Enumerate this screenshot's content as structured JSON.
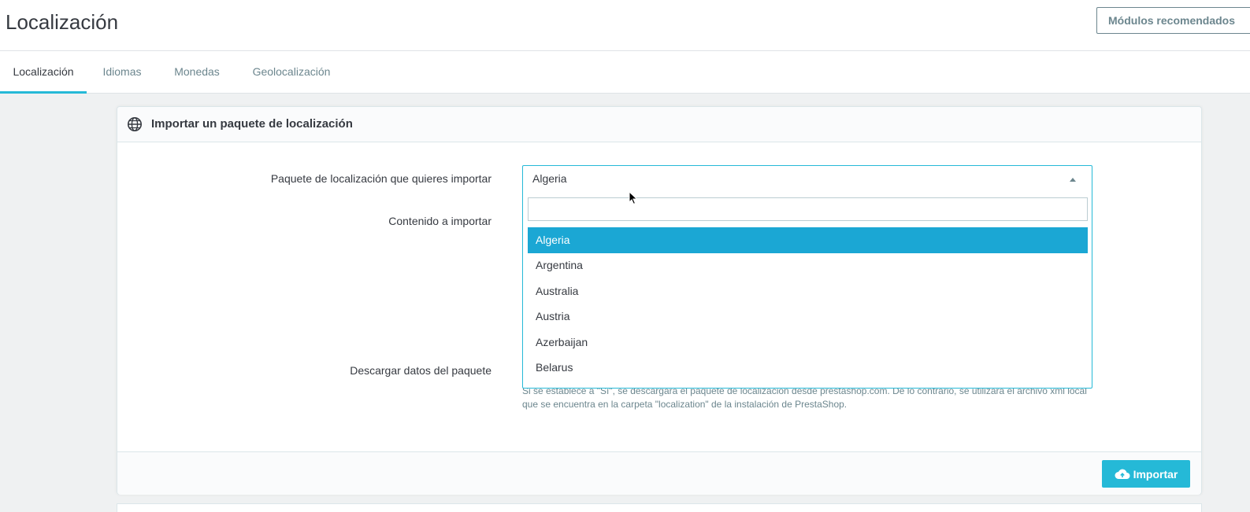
{
  "header": {
    "title": "Localización",
    "recommended_modules_label": "Módulos recomendados"
  },
  "tabs": [
    {
      "label": "Localización",
      "active": true
    },
    {
      "label": "Idiomas",
      "active": false
    },
    {
      "label": "Monedas",
      "active": false
    },
    {
      "label": "Geolocalización",
      "active": false
    }
  ],
  "card": {
    "title": "Importar un paquete de localización",
    "icon": "globe-icon",
    "fields": {
      "package_label": "Paquete de localización que quieres importar",
      "content_label": "Contenido a importar",
      "download_label": "Descargar datos del paquete"
    },
    "select": {
      "current_value": "Algeria",
      "search_value": "",
      "options": [
        "Algeria",
        "Argentina",
        "Australia",
        "Austria",
        "Azerbaijan",
        "Belarus"
      ],
      "highlighted": "Algeria"
    },
    "help_text": "Si se establece a \"Sí\", se descargará el paquete de localización desde prestashop.com. De lo contrario, se utilizará el archivo xml local que se encuentra en la carpeta \"localization\" de la instalación de PrestaShop.",
    "import_button_label": "Importar"
  },
  "colors": {
    "accent": "#25b9d7",
    "highlight": "#1ba7d4",
    "text": "#363a41",
    "muted": "#6c868e"
  }
}
